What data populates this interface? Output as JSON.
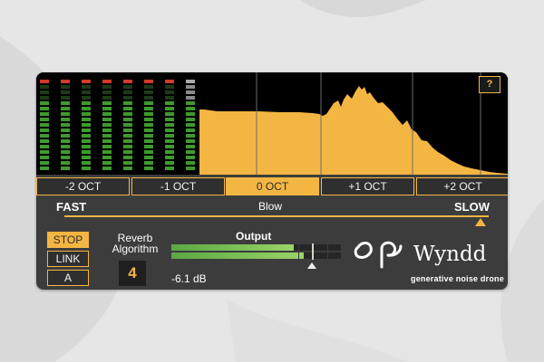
{
  "help_label": "?",
  "octaves": [
    {
      "label": "-2 OCT",
      "active": false
    },
    {
      "label": "-1 OCT",
      "active": false
    },
    {
      "label": "0 OCT",
      "active": true
    },
    {
      "label": "+1 OCT",
      "active": false
    },
    {
      "label": "+2 OCT",
      "active": false
    }
  ],
  "speed": {
    "left_label": "FAST",
    "right_label": "SLOW",
    "mode_label": "Blow",
    "value": 1.0
  },
  "transport": {
    "stop_label": "STOP",
    "link_label": "LINK",
    "a_label": "A"
  },
  "reverb": {
    "label_line1": "Reverb",
    "label_line2": "Algorithm",
    "value": "4"
  },
  "output": {
    "label": "Output",
    "readout": "-6.1 dB",
    "level_top": 0.72,
    "level_bottom": 0.78,
    "gain": 0.83
  },
  "brand": {
    "name": "Wyndd",
    "tagline": "generative noise drone"
  },
  "meters": {
    "levels": [
      0.76,
      0.76,
      0.76,
      0.76,
      0.76,
      0.76,
      0.76,
      0.76
    ]
  },
  "colors": {
    "accent": "#f4b642",
    "meter_green": "#3f9a2e",
    "meter_yellow": "#b8a63a",
    "meter_red": "#d23a2a",
    "panel": "#3c3c3c"
  }
}
